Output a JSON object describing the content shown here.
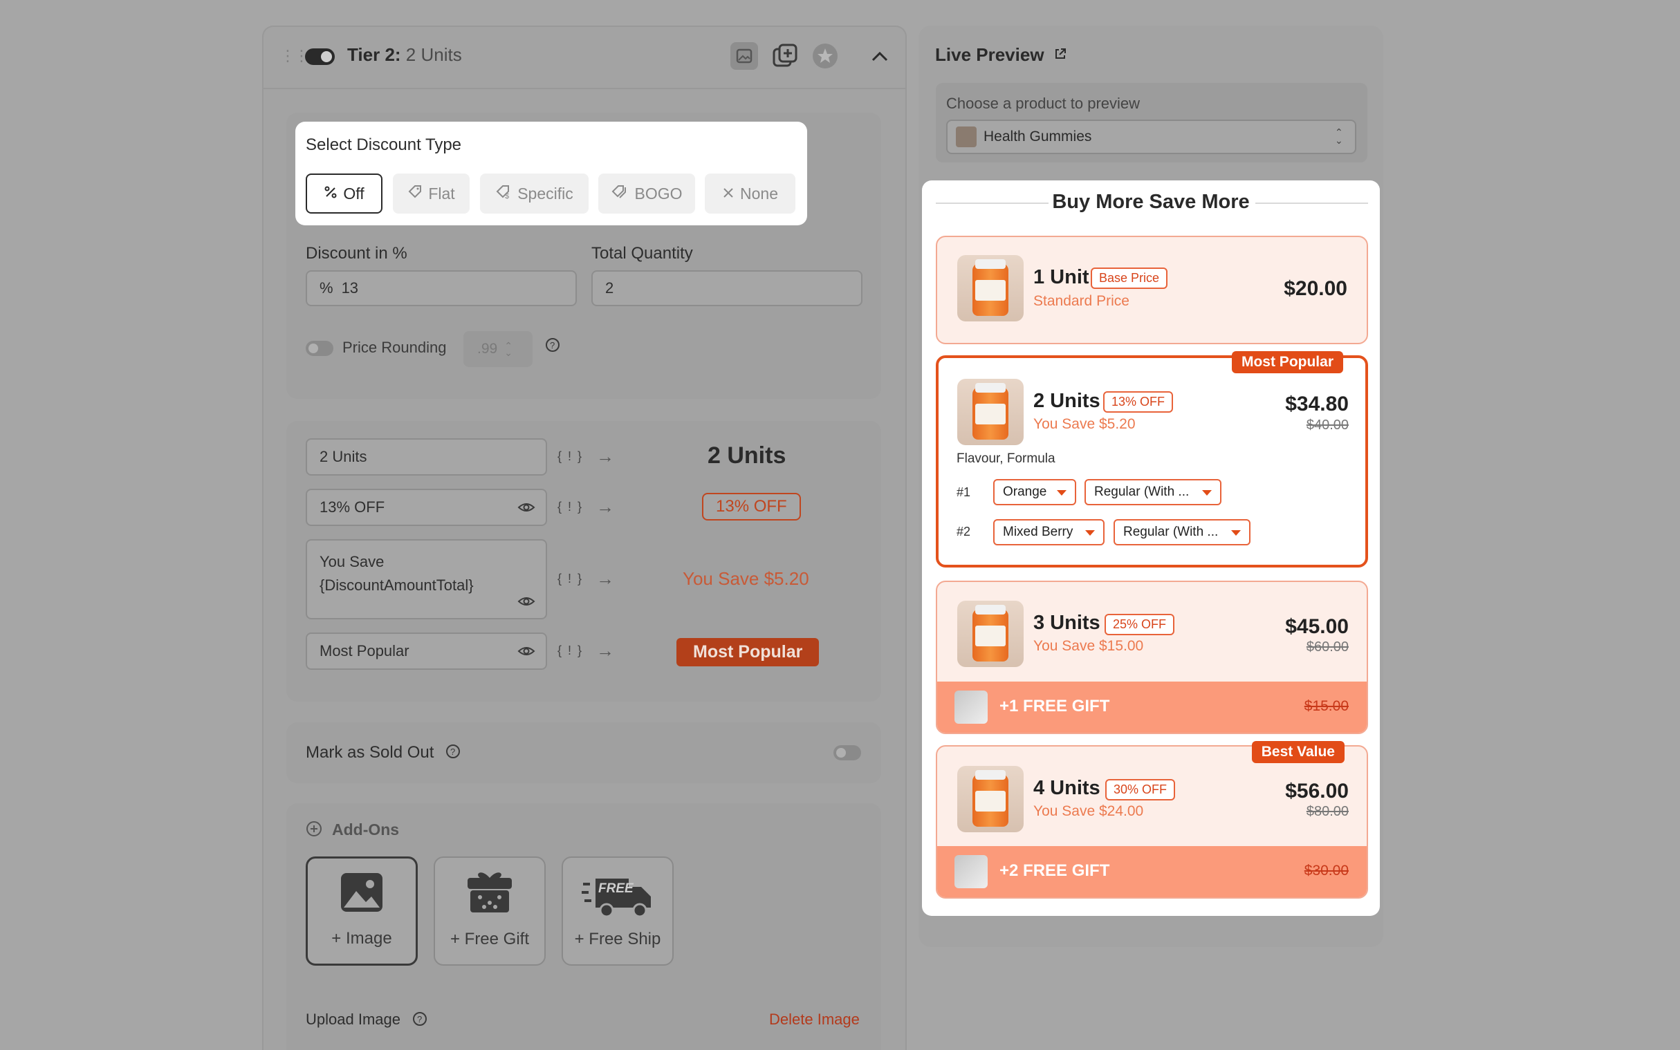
{
  "tier": {
    "label": "Tier 2:",
    "name": "2 Units"
  },
  "discount_type": {
    "heading": "Select Discount Type",
    "options": [
      {
        "label": "Off",
        "icon": "percent-icon",
        "active": true
      },
      {
        "label": "Flat",
        "icon": "tag-icon"
      },
      {
        "label": "Specific",
        "icon": "dollar-tag-icon"
      },
      {
        "label": "BOGO",
        "icon": "tags-icon"
      },
      {
        "label": "None",
        "icon": "close-icon"
      }
    ]
  },
  "discount": {
    "label": "Discount in %",
    "prefix": "%",
    "value": "13"
  },
  "quantity": {
    "label": "Total Quantity",
    "value": "2"
  },
  "rounding": {
    "label": "Price Rounding",
    "value": ".99"
  },
  "text_fields": [
    {
      "input": "2 Units",
      "preview": "2 Units"
    },
    {
      "input": "13% OFF",
      "preview": "13% OFF"
    },
    {
      "input": "You Save {DiscountAmountTotal}",
      "preview": "You Save $5.20"
    },
    {
      "input": "Most Popular",
      "preview": "Most Popular"
    }
  ],
  "brace_label": "{ ! }",
  "sold_out": {
    "label": "Mark as Sold Out"
  },
  "addons": {
    "heading": "Add-Ons",
    "buttons": [
      "+ Image",
      "+ Free Gift",
      "+ Free Ship"
    ],
    "free_label": "FREE"
  },
  "upload": {
    "label": "Upload Image",
    "delete": "Delete Image"
  },
  "live_preview": {
    "title": "Live Preview",
    "choose_label": "Choose a product to preview",
    "product": "Health Gummies",
    "heading": "Buy More Save More",
    "tiers": [
      {
        "units": "1 Unit",
        "badge": "Base Price",
        "sub": "Standard Price",
        "price": "$20.00"
      },
      {
        "units": "2 Units",
        "badge": "13% OFF",
        "sub": "You Save $5.20",
        "price": "$34.80",
        "old": "$40.00",
        "ribbon": "Most Popular",
        "variant_label": "Flavour, Formula",
        "variants": [
          {
            "num": "#1",
            "flavour": "Orange",
            "formula": "Regular (With ..."
          },
          {
            "num": "#2",
            "flavour": "Mixed Berry",
            "formula": "Regular (With ..."
          }
        ]
      },
      {
        "units": "3 Units",
        "badge": "25% OFF",
        "sub": "You Save $15.00",
        "price": "$45.00",
        "old": "$60.00",
        "gift": "+1 FREE GIFT",
        "gift_old": "$15.00"
      },
      {
        "units": "4 Units",
        "badge": "30% OFF",
        "sub": "You Save $24.00",
        "price": "$56.00",
        "old": "$80.00",
        "ribbon": "Best Value",
        "gift": "+2 FREE GIFT",
        "gift_old": "$30.00"
      }
    ]
  },
  "colors": {
    "accent": "#e24c17",
    "tier_bg": "#fdeee8",
    "gift_bg": "#fb9a7a"
  }
}
